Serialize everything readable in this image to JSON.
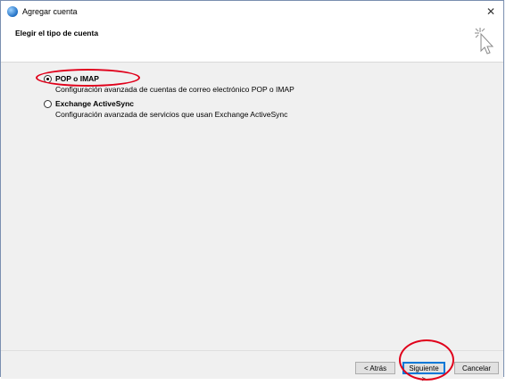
{
  "window": {
    "title": "Agregar cuenta",
    "close_glyph": "✕"
  },
  "header": {
    "title": "Elegir el tipo de cuenta"
  },
  "options": [
    {
      "label": "POP o IMAP",
      "description": "Configuración avanzada de cuentas de correo electrónico POP o IMAP",
      "selected": true
    },
    {
      "label": "Exchange ActiveSync",
      "description": "Configuración avanzada de servicios que usan Exchange ActiveSync",
      "selected": false
    }
  ],
  "buttons": {
    "back": "< Atrás",
    "next": "Siguiente >",
    "cancel": "Cancelar"
  },
  "colors": {
    "annotation": "#e0001a",
    "accent": "#0078d7"
  }
}
